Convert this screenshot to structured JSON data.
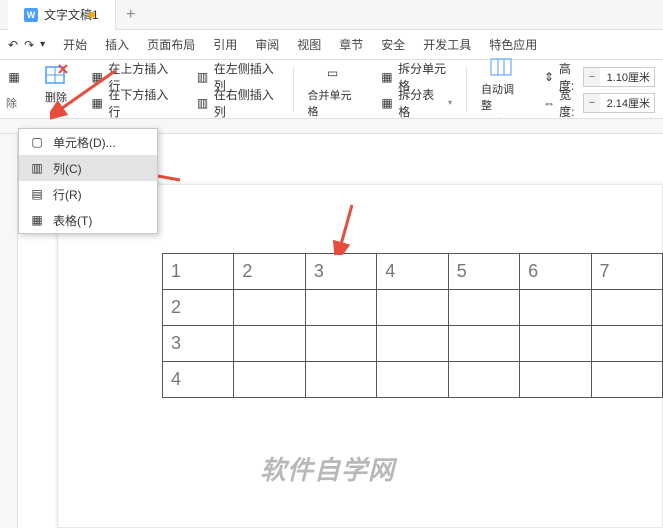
{
  "tab": {
    "title": "文字文稿1"
  },
  "menus": [
    "开始",
    "插入",
    "页面布局",
    "引用",
    "审阅",
    "视图",
    "章节",
    "安全",
    "开发工具",
    "特色应用"
  ],
  "ribbon": {
    "delete": "删除",
    "insertAbove": "在上方插入行",
    "insertBelow": "在下方插入行",
    "insertLeft": "在左侧插入列",
    "insertRight": "在右侧插入列",
    "mergeCells": "合并单元格",
    "splitCells": "拆分单元格",
    "splitTable": "拆分表格",
    "autoFit": "自动调整",
    "height": "高度:",
    "width": "宽度:",
    "heightVal": "1.10厘米",
    "widthVal": "2.14厘米"
  },
  "dropdown": {
    "cell": "单元格(D)...",
    "column": "列(C)",
    "row": "行(R)",
    "table": "表格(T)"
  },
  "table": {
    "r1": [
      "1",
      "2",
      "3",
      "4",
      "5",
      "6",
      "7"
    ],
    "rHead": [
      "2",
      "3",
      "4"
    ]
  },
  "watermark": "软件自学网"
}
